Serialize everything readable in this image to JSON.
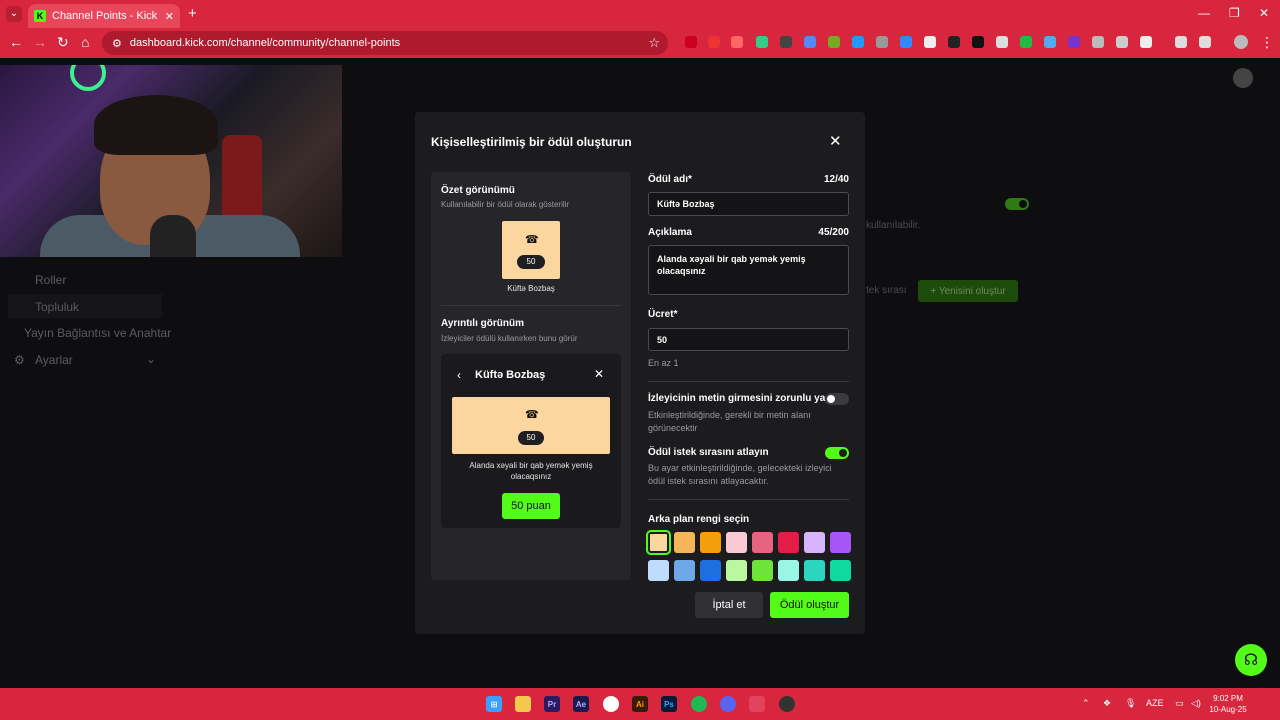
{
  "browser": {
    "tab_title": "Channel Points - Kick Dashboard",
    "tab_favicon": "K",
    "url": "dashboard.kick.com/channel/community/channel-points"
  },
  "sidebar": {
    "items": [
      {
        "label": "Roller"
      },
      {
        "label": "Topluluk"
      },
      {
        "label": "Yayın Bağlantısı ve Anahtar"
      },
      {
        "label": "Ayarlar"
      }
    ]
  },
  "background": {
    "desc_fragment": "kullanılabilir.",
    "queue_fragment": "tek sırası",
    "new_button": "+ Yenisini oluştur"
  },
  "modal": {
    "title": "Kişiselleştirilmiş bir ödül oluşturun",
    "summary": {
      "heading": "Özet görünümü",
      "sub": "Kullanılabilir bir ödül olarak gösterilir",
      "cost": "50",
      "name": "Küftə Bozbaş"
    },
    "detail": {
      "heading": "Ayrıntılı görünüm",
      "sub": "İzleyiciler ödülü kullanırken bunu görür",
      "name": "Küftə Bozbaş",
      "cost": "50",
      "description": "Alanda xəyali bir qab yemək yemiş olacaqsınız",
      "button": "50 puan"
    },
    "form": {
      "name_label": "Ödül adı*",
      "name_count": "12/40",
      "name_value": "Küftə Bozbaş",
      "desc_label": "Açıklama",
      "desc_count": "45/200",
      "desc_value": "Alanda xəyali bir qab yemək yemiş olacaqsınız",
      "cost_label": "Ücret*",
      "cost_value": "50",
      "cost_hint": "En az 1",
      "require_text_label": "İzleyicinin metin girmesini zorunlu yap",
      "require_text_hint": "Etkinleştirildiğinde, gerekli bir metin alanı görünecektir",
      "require_text_on": false,
      "skip_queue_label": "Ödül istek sırasını atlayın",
      "skip_queue_hint": "Bu ayar etkinleştirildiğinde, gelecekteki izleyici ödül istek sırasını atlayacaktır.",
      "skip_queue_on": true,
      "color_label": "Arka plan rengi seçin",
      "colors": [
        "#fbd69e",
        "#f7b55a",
        "#f59e0b",
        "#f9c9d4",
        "#e8637f",
        "#e11d48",
        "#d8b4fe",
        "#a855f7",
        "#bfdbfe",
        "#6ea8e8",
        "#1d6fe0",
        "#bbf7a0",
        "#6ee33a",
        "#99f6e4",
        "#2dd4bf",
        "#10d9a0"
      ],
      "selected_color": 0
    },
    "cancel_button": "İptal et",
    "create_button": "Ödül oluştur"
  },
  "taskbar": {
    "lang": "AZE",
    "time": "9:02 PM",
    "date": "10-Aug-25"
  }
}
